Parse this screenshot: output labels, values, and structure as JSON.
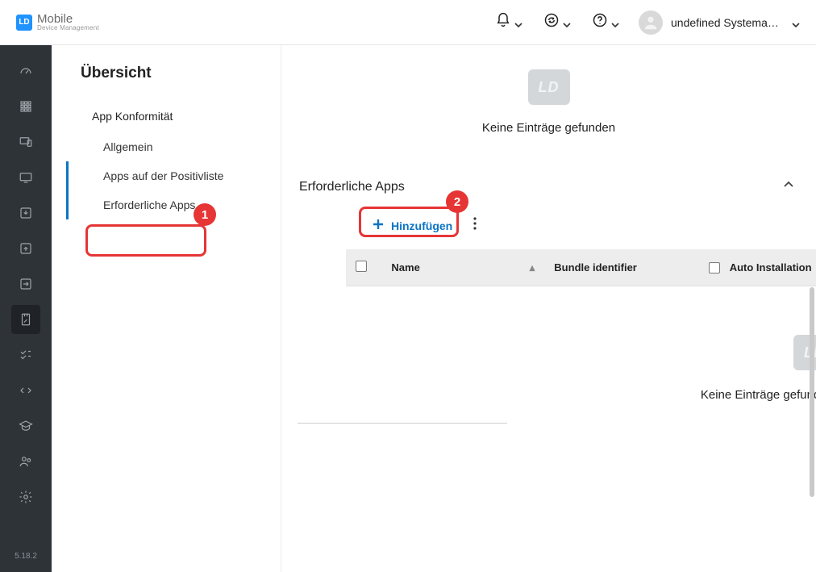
{
  "brand": {
    "logo_text": "LD",
    "title": "Mobile",
    "subtitle": "Device Management"
  },
  "header": {
    "user_name": "undefined Systemadmi…"
  },
  "rail": {
    "version": "5.18.2"
  },
  "sidebar": {
    "title": "Übersicht",
    "group": "App Konformität",
    "items": [
      "Allgemein",
      "Apps auf der Positivliste",
      "Erforderliche Apps"
    ],
    "selected_index": 2
  },
  "main": {
    "empty1": {
      "placeholder": "LD",
      "text": "Keine Einträge gefunden"
    },
    "section_title": "Erforderliche Apps",
    "add_label": "Hinzufügen",
    "table": {
      "columns": [
        "Name",
        "Bundle identifier",
        "Auto Installation"
      ]
    },
    "empty2": {
      "placeholder": "LD",
      "text": "Keine Einträge gefunden"
    }
  },
  "annotations": {
    "c1": "1",
    "c2": "2"
  }
}
